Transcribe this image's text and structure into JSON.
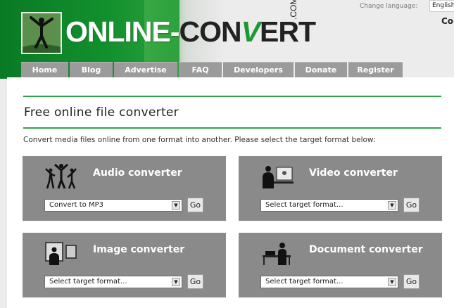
{
  "header": {
    "logo_white": "ONLINE-",
    "logo_dark": "CON",
    "logo_green": "V",
    "logo_dark2": "ERT",
    "logo_com": ".COM",
    "change_language_label": "Change language:",
    "language_value": "English",
    "corner_text": "Co"
  },
  "nav": [
    {
      "label": "Home"
    },
    {
      "label": "Blog"
    },
    {
      "label": "Advertise"
    },
    {
      "label": "FAQ"
    },
    {
      "label": "Developers"
    },
    {
      "label": "Donate"
    },
    {
      "label": "Register"
    }
  ],
  "main": {
    "title": "Free online file converter",
    "subtitle": "Convert media files online from one format into another. Please select the target format below:"
  },
  "converters": {
    "audio": {
      "title": "Audio converter",
      "selected": "Convert to MP3",
      "go": "Go"
    },
    "video": {
      "title": "Video converter",
      "selected": "Select target format...",
      "go": "Go"
    },
    "image": {
      "title": "Image converter",
      "selected": "Select target format...",
      "go": "Go"
    },
    "document": {
      "title": "Document converter",
      "selected": "Select target format...",
      "go": "Go"
    }
  },
  "colors": {
    "brand_green": "#2fa446",
    "panel_gray": "#8a8a8a",
    "nav_gray": "#9b9b9b"
  }
}
